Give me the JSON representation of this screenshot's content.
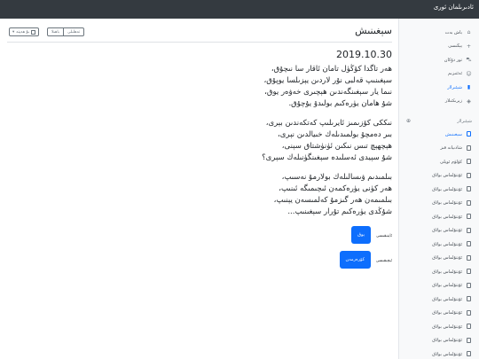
{
  "app": {
    "brand": "ئادىرىلمان ئورى"
  },
  "sidebar": {
    "items": [
      {
        "label": "باش بەت",
        "icon": "home-icon",
        "active": false
      },
      {
        "label": "يېڭىسى",
        "icon": "plus-icon",
        "active": false
      },
      {
        "label": "تور دۇكان",
        "icon": "cart-icon",
        "active": false
      },
      {
        "label": "ئەئتىزىم",
        "icon": "users-icon",
        "active": false
      },
      {
        "label": "شېئىرلار",
        "icon": "chart-icon",
        "active": true
      },
      {
        "label": "زېرىكتىلار",
        "icon": "layers-icon",
        "active": false
      }
    ],
    "heading": "شېئىرلار",
    "posts": [
      {
        "label": "سېغىنىش",
        "active": true
      },
      {
        "label": "شادىيانە قىز",
        "active": false
      },
      {
        "label": "كۈلۈم ئويلى",
        "active": false
      },
      {
        "label": "ئۇنتۇلماس بولاق",
        "active": false
      },
      {
        "label": "ئۇنتۇلماس بولاق",
        "active": false
      },
      {
        "label": "ئۇنتۇلماس بولاق",
        "active": false
      },
      {
        "label": "ئۇنتۇلماس بولاق",
        "active": false
      },
      {
        "label": "ئۇنتۇلماس بولاق",
        "active": false
      },
      {
        "label": "ئۇنتۇلماس بولاق",
        "active": false
      },
      {
        "label": "ئۇنتۇلماس بولاق",
        "active": false
      },
      {
        "label": "ئۇنتۇلماس بولاق",
        "active": false
      },
      {
        "label": "ئۇنتۇلماس بولاق",
        "active": false
      },
      {
        "label": "ئۇنتۇلماس بولاق",
        "active": false
      },
      {
        "label": "ئۇنتۇلماس بولاق",
        "active": false
      },
      {
        "label": "ئۇنتۇلماس بولاق",
        "active": false
      },
      {
        "label": "ئۇنتۇلماس بولاق",
        "active": false
      },
      {
        "label": "ئۇنتۇلماس بولاق",
        "active": false
      }
    ]
  },
  "header": {
    "title": "سېغىنىش",
    "share_label": "تەھلىلى",
    "export_label": "باھىلا",
    "dropdown_label": "بۇ ھەپتە"
  },
  "post": {
    "date": "2019.10.30",
    "stanzas": [
      [
        "ھەر تاگدا كۆڭۈل تامان ئاقار سا نىچۇق،",
        "سېغىنىپ قەلبى نۇر لاردىن يېزىلسا يوپۇق،",
        "نىما يار سېغىنگەندىن ھېچىرى خەۋەر يوق،",
        "شۇ ھامان يۈرەكىم بولىدۇ يۇچۇق."
      ],
      [
        "نىككى كۆزىمىز ئايرىلىپ كەتكەندىن بېرى،",
        "بىر دەمچۇ بولمىدىلەك خىيالدىن نېرى،",
        "ھېچھېچ تىس نىكىن ئۈنۈشتاق سېنى،",
        "شۇ سېيدى ئەسلىدە سېغىنگۈنىلەك سېرى؟"
      ],
      [
        "بىلمىدىم ۋىسالىلەك بولارمۇ نەسىپ،",
        "ھەر كۈنى يۈرەكمەن ئىچىمىگە ئىنىپ،",
        "بىلمىمەن ھەر گىزمۇ كەلمىسەن يېنىپ،",
        "شۇڭدى يۈرەكىم تۇرار سېغىنىپ..."
      ]
    ]
  },
  "actions": {
    "like": {
      "label": "ئاينىقىسى",
      "button": "يوق"
    },
    "comment": {
      "label": "ئېچىقىسى",
      "button": "كۆرەرمەن"
    }
  },
  "colors": {
    "primary": "#0d6efd",
    "topbar": "#343a40",
    "sidebar_bg": "#f8f9fa"
  }
}
